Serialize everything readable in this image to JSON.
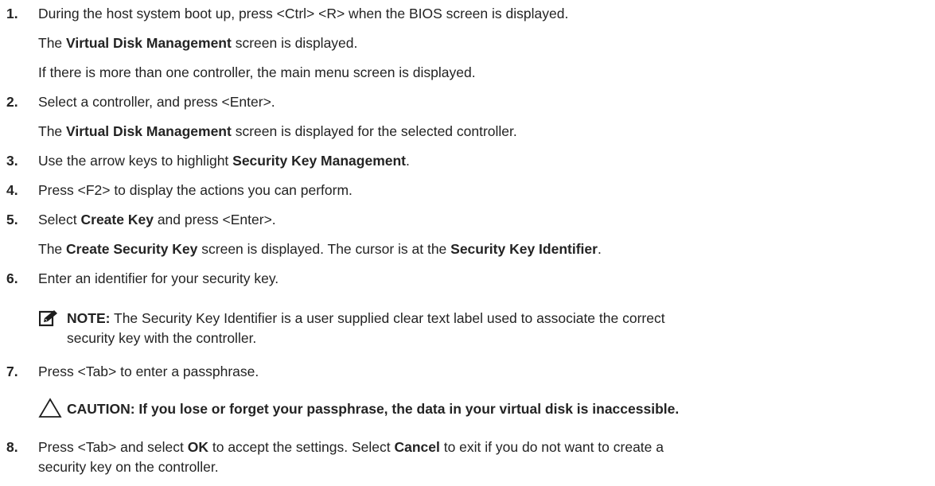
{
  "steps": [
    {
      "number": "1.",
      "text_parts": [
        "During the host system boot up, press <Ctrl> <R> when the BIOS screen is displayed."
      ],
      "results": [
        {
          "pre": "The ",
          "bold": "Virtual Disk Management",
          "post": " screen is displayed."
        },
        {
          "pre": "If there is more than one controller, the main menu screen is displayed."
        }
      ]
    },
    {
      "number": "2.",
      "text_parts": [
        "Select a controller, and press <Enter>."
      ],
      "results": [
        {
          "pre": "The ",
          "bold": "Virtual Disk Management",
          "post": " screen is displayed for the selected controller."
        }
      ]
    },
    {
      "number": "3.",
      "pre": "Use the arrow keys to highlight ",
      "bold": "Security Key Management",
      "post": "."
    },
    {
      "number": "4.",
      "pre": "Press <F2> to display the actions you can perform."
    },
    {
      "number": "5.",
      "pre": "Select ",
      "bold": "Create Key",
      "post": " and press <Enter>.",
      "result": {
        "pre": "The ",
        "bold1": "Create Security Key",
        "mid": " screen is displayed. The cursor is at the ",
        "bold2": "Security Key Identifier",
        "post": "."
      }
    },
    {
      "number": "6.",
      "pre": "Enter an identifier for your security key."
    },
    {
      "number": "7.",
      "pre": "Press <Tab> to enter a passphrase."
    },
    {
      "number": "8.",
      "pre": "Press <Tab> and select ",
      "bold1": "OK",
      "mid": " to accept the settings. Select ",
      "bold2": "Cancel",
      "post": " to exit if you do not want to create a",
      "continuation": "security key on the controller."
    }
  ],
  "note": {
    "label": "NOTE:",
    "line1": " The Security Key Identifier is a user supplied clear text label used to associate the correct",
    "line2": "security key with the controller.",
    "icon": "pencil-note-icon"
  },
  "caution": {
    "text": "CAUTION: If you lose or forget your passphrase, the data in your virtual disk is inaccessible.",
    "icon": "warning-triangle-icon"
  }
}
